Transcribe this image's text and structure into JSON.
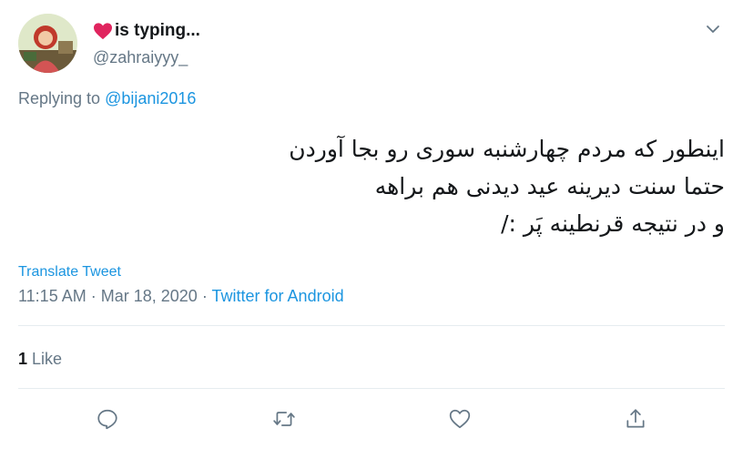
{
  "tweet": {
    "display_name": "is typing...",
    "handle": "@zahraiyyy_",
    "replying_prefix": "Replying to",
    "replying_handle": "@bijani2016",
    "lines": [
      "اینطور که مردم چهارشنبه سوری رو بجا آوردن",
      "حتما سنت دیرینه عید دیدنی هم براهه",
      "و در نتیجه قرنطینه پَر :/"
    ],
    "translate_label": "Translate Tweet",
    "time": "11:15 AM",
    "separator": "·",
    "date": "Mar 18, 2020",
    "source": "Twitter for Android",
    "like_count": "1",
    "like_label": "Like"
  },
  "colors": {
    "accent": "#1b95e0",
    "muted": "#657786",
    "heart": "#e0245e",
    "divider": "#e6ecf0"
  },
  "icons": [
    "heart-emoji-icon",
    "chevron-down-icon",
    "reply-icon",
    "retweet-icon",
    "like-icon",
    "share-icon"
  ]
}
